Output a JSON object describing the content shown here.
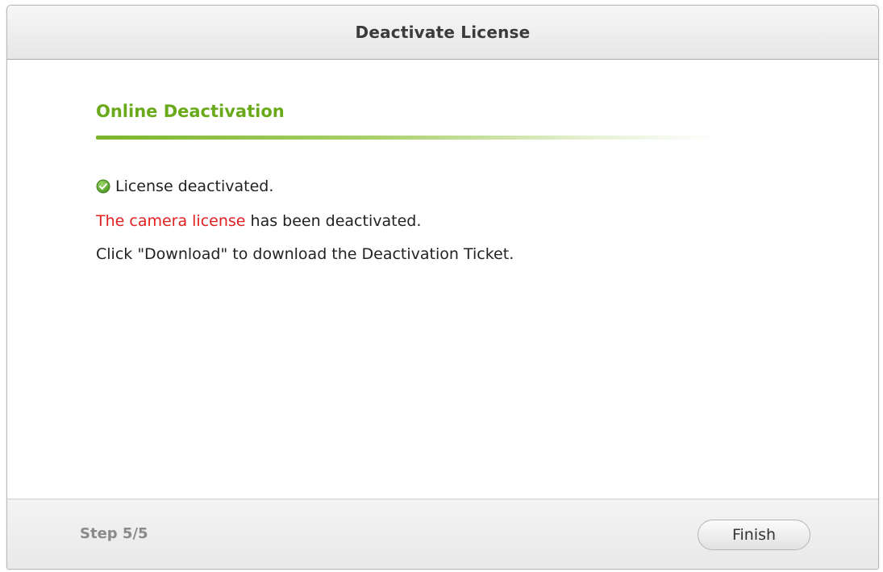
{
  "dialog": {
    "title": "Deactivate License"
  },
  "content": {
    "section_title": "Online Deactivation",
    "status_icon": "check-circle-icon",
    "status_text": "License deactivated.",
    "message_highlight": "The camera license",
    "message_rest": " has been deactivated.",
    "instruction": "Click \"Download\" to download the Deactivation Ticket."
  },
  "footer": {
    "step_label": "Step 5/5",
    "finish_label": "Finish"
  },
  "colors": {
    "section_title": "#6aaa1a",
    "highlight": "#e02020",
    "success_icon": "#5aa52a"
  }
}
